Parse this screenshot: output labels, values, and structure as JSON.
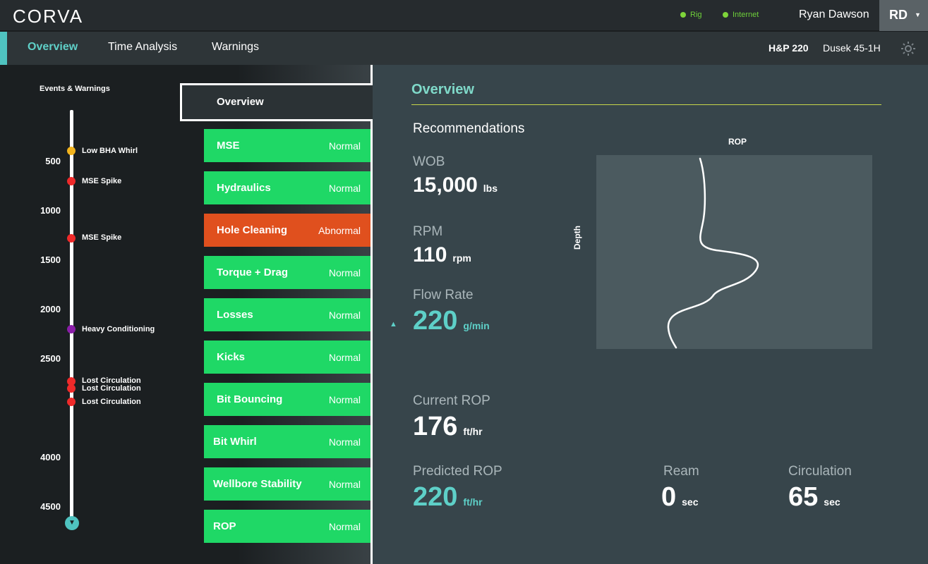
{
  "header": {
    "logo": "CORVA",
    "status_rig": "Rig",
    "status_internet": "Internet",
    "user_name": "Ryan Dawson",
    "user_initials": "RD",
    "status_color": "#7ed43a"
  },
  "nav": {
    "tabs": [
      {
        "label": "Overview",
        "active": true
      },
      {
        "label": "Time Analysis",
        "active": false
      },
      {
        "label": "Warnings",
        "active": false
      }
    ],
    "rig": "H&P 220",
    "well": "Dusek 45-1H"
  },
  "timeline": {
    "title": "Events & Warnings",
    "depths": [
      "500",
      "1000",
      "1500",
      "2000",
      "2500",
      "4000",
      "4500"
    ],
    "events": [
      {
        "label": "Low BHA Whirl",
        "color": "#f2b31d"
      },
      {
        "label": "MSE Spike",
        "color": "#ef2a2a"
      },
      {
        "label": "MSE Spike",
        "color": "#ef2a2a"
      },
      {
        "label": "Heavy Conditioning",
        "color": "#8a1ea8"
      },
      {
        "label": "Lost Circulation",
        "color": "#ef2a2a"
      },
      {
        "label": "Lost Circulation",
        "color": "#ef2a2a"
      },
      {
        "label": "Lost Circulation",
        "color": "#ef2a2a"
      }
    ]
  },
  "categories": {
    "overview_label": "Overview",
    "items": [
      {
        "name": "MSE",
        "state": "Normal"
      },
      {
        "name": "Hydraulics",
        "state": "Normal"
      },
      {
        "name": "Hole Cleaning",
        "state": "Abnormal"
      },
      {
        "name": "Torque + Drag",
        "state": "Normal"
      },
      {
        "name": "Losses",
        "state": "Normal"
      },
      {
        "name": "Kicks",
        "state": "Normal"
      },
      {
        "name": "Bit Bouncing",
        "state": "Normal"
      },
      {
        "name": "Bit Whirl",
        "state": "Normal"
      },
      {
        "name": "Wellbore Stability",
        "state": "Normal"
      },
      {
        "name": "ROP",
        "state": "Normal"
      }
    ],
    "normal_color": "#1fd866",
    "abnormal_color": "#e0501e"
  },
  "panel": {
    "title": "Overview",
    "recommendations_title": "Recommendations",
    "wob": {
      "label": "WOB",
      "value": "15,000",
      "unit": "lbs"
    },
    "rpm": {
      "label": "RPM",
      "value": "110",
      "unit": "rpm"
    },
    "flow": {
      "label": "Flow Rate",
      "value": "220",
      "unit": "g/min"
    },
    "current_rop": {
      "label": "Current ROP",
      "value": "176",
      "unit": "ft/hr"
    },
    "predicted_rop": {
      "label": "Predicted ROP",
      "value": "220",
      "unit": "ft/hr"
    },
    "ream": {
      "label": "Ream",
      "value": "0",
      "unit": "sec"
    },
    "circulation": {
      "label": "Circulation",
      "value": "65",
      "unit": "sec"
    },
    "accent_color": "#5ed0c8"
  },
  "rop_chart": {
    "title": "ROP",
    "ylabel": "Depth"
  }
}
